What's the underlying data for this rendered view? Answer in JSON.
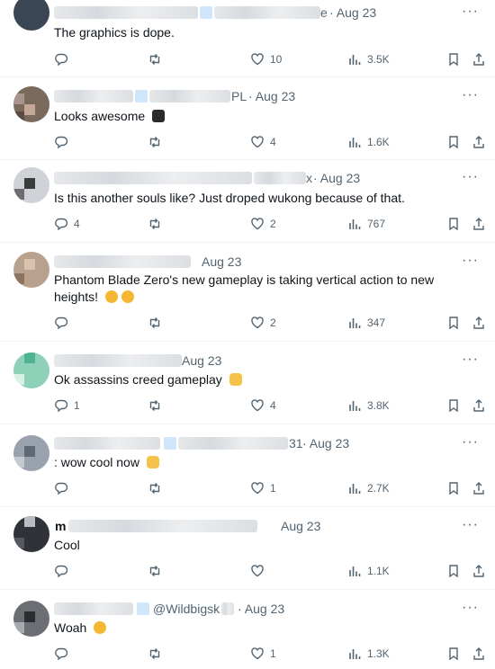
{
  "replies": [
    {
      "name_tail": "e",
      "date": "· Aug 23",
      "text": "The graphics is dope.",
      "replies": "",
      "likes": "10",
      "views": "3.5K"
    },
    {
      "name_tail": "PL",
      "date": "· Aug 23",
      "text": "Looks awesome",
      "replies": "",
      "likes": "4",
      "views": "1.6K"
    },
    {
      "name_tail": "x",
      "date": "· Aug 23",
      "text": "Is this another souls like? Just droped wukong because of that.",
      "replies": "4",
      "likes": "2",
      "views": "767"
    },
    {
      "name_tail": "",
      "date": "Aug 23",
      "text": "Phantom Blade Zero's new gameplay is taking vertical action to new heights!",
      "replies": "",
      "likes": "2",
      "views": "347"
    },
    {
      "name_tail": "",
      "date": "Aug 23",
      "text": "Ok assassins creed gameplay",
      "replies": "1",
      "likes": "4",
      "views": "3.8K"
    },
    {
      "name_tail": "31",
      "date": "· Aug 23",
      "text": ": wow cool now",
      "replies": "",
      "likes": "1",
      "views": "2.7K"
    },
    {
      "name_tail": "m",
      "date": "Aug 23",
      "text": "Cool",
      "replies": "",
      "likes": "",
      "views": "1.1K"
    },
    {
      "name_tail": "@Wildbigsk",
      "date": "· Aug 23",
      "text": "Woah",
      "replies": "",
      "likes": "1",
      "views": "1.3K"
    }
  ],
  "icons": {
    "reply": "reply-icon",
    "retweet": "retweet-icon",
    "like": "heart-icon",
    "views": "views-icon",
    "bookmark": "bookmark-icon",
    "share": "share-icon",
    "more": "more-icon"
  },
  "colors": {
    "muted": "#536471",
    "text": "#0f1419",
    "divider": "#eff3f4"
  }
}
